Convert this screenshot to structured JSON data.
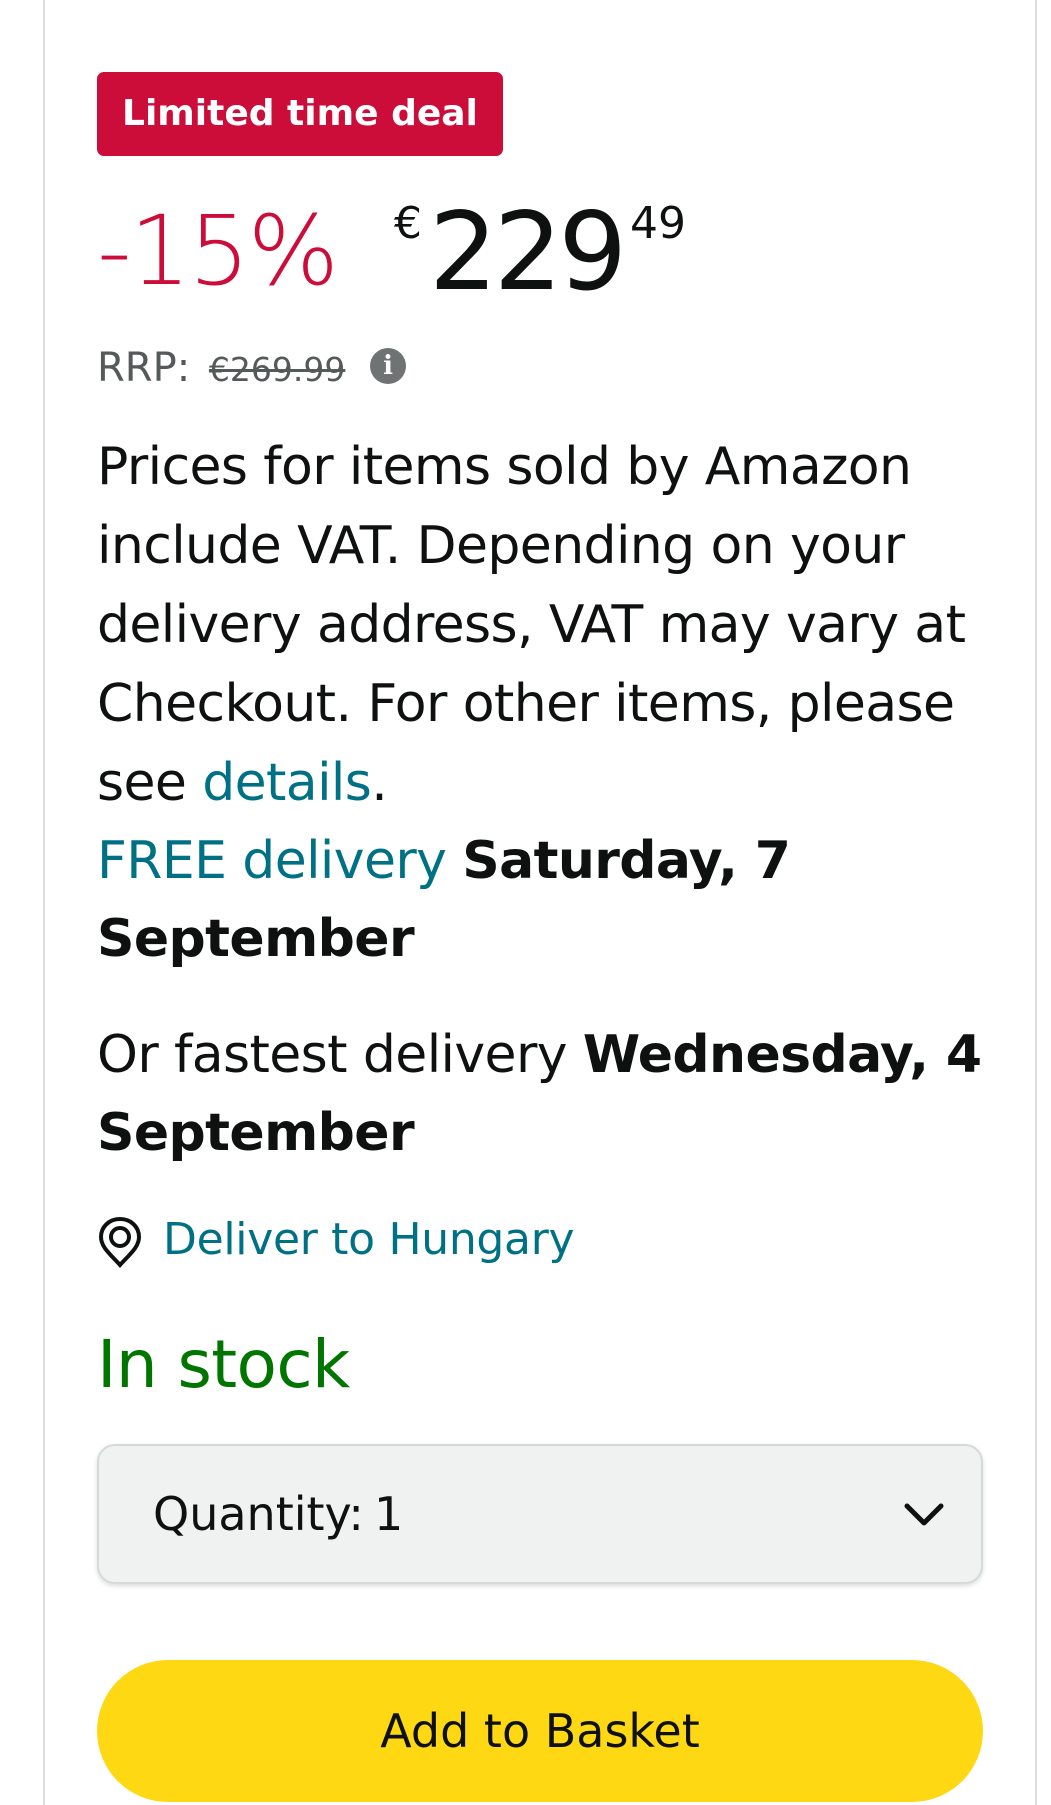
{
  "deal_badge": "Limited time deal",
  "price": {
    "discount": "-15%",
    "currency": "€",
    "whole": "229",
    "fraction": "49"
  },
  "rrp": {
    "label": "RRP:",
    "value": "€269.99",
    "info_icon": "info-icon"
  },
  "vat_notice": {
    "text": "Prices for items sold by Amazon include VAT. Depending on your delivery address, VAT may vary at Checkout. For other items, please see ",
    "link": "details",
    "suffix": "."
  },
  "delivery": {
    "free_label": "FREE delivery",
    "free_date": "Saturday, 7 September",
    "fast_label": "Or fastest delivery",
    "fast_date": "Wednesday, 4 September"
  },
  "deliver_to": {
    "icon": "location-pin-icon",
    "label": "Deliver to Hungary"
  },
  "stock_status": "In stock",
  "quantity": {
    "label": "Quantity:",
    "value": "1",
    "icon": "chevron-down-icon"
  },
  "add_to_basket": "Add to Basket",
  "colors": {
    "deal_red": "#cc0c39",
    "link_teal": "#007185",
    "stock_green": "#007600",
    "button_yellow": "#ffd814",
    "select_bg": "#f0f2f2"
  }
}
